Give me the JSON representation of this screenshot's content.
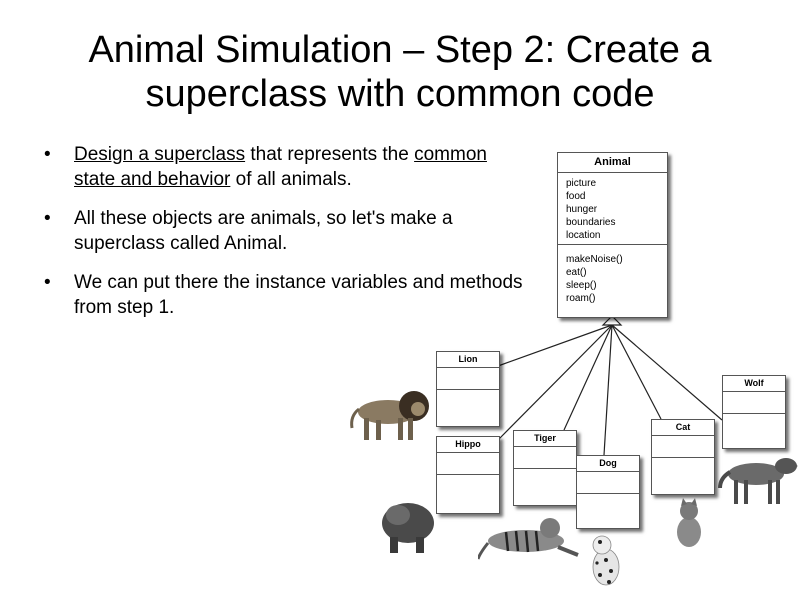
{
  "slide": {
    "title": "Animal Simulation – Step 2: Create a superclass with common code",
    "bullets": [
      {
        "part1": "Design a superclass",
        "part2": " that represents the ",
        "part3": "common state and behavior",
        "part4": " of all animals."
      },
      {
        "text": "All these objects are animals, so let's make a superclass called Animal."
      },
      {
        "text": "We can put there the instance variables and methods from step 1."
      }
    ]
  },
  "uml": {
    "superclass": {
      "name": "Animal",
      "variables": [
        "picture",
        "food",
        "hunger",
        "boundaries",
        "location"
      ],
      "methods": [
        "makeNoise()",
        "eat()",
        "sleep()",
        "roam()"
      ]
    },
    "subclasses": [
      {
        "name": "Lion"
      },
      {
        "name": "Hippo"
      },
      {
        "name": "Tiger"
      },
      {
        "name": "Dog"
      },
      {
        "name": "Cat"
      },
      {
        "name": "Wolf"
      }
    ]
  },
  "images": [
    {
      "icon": "lion-photo"
    },
    {
      "icon": "hippo-photo"
    },
    {
      "icon": "tiger-photo"
    },
    {
      "icon": "dog-photo"
    },
    {
      "icon": "cat-photo"
    },
    {
      "icon": "wolf-photo"
    }
  ]
}
